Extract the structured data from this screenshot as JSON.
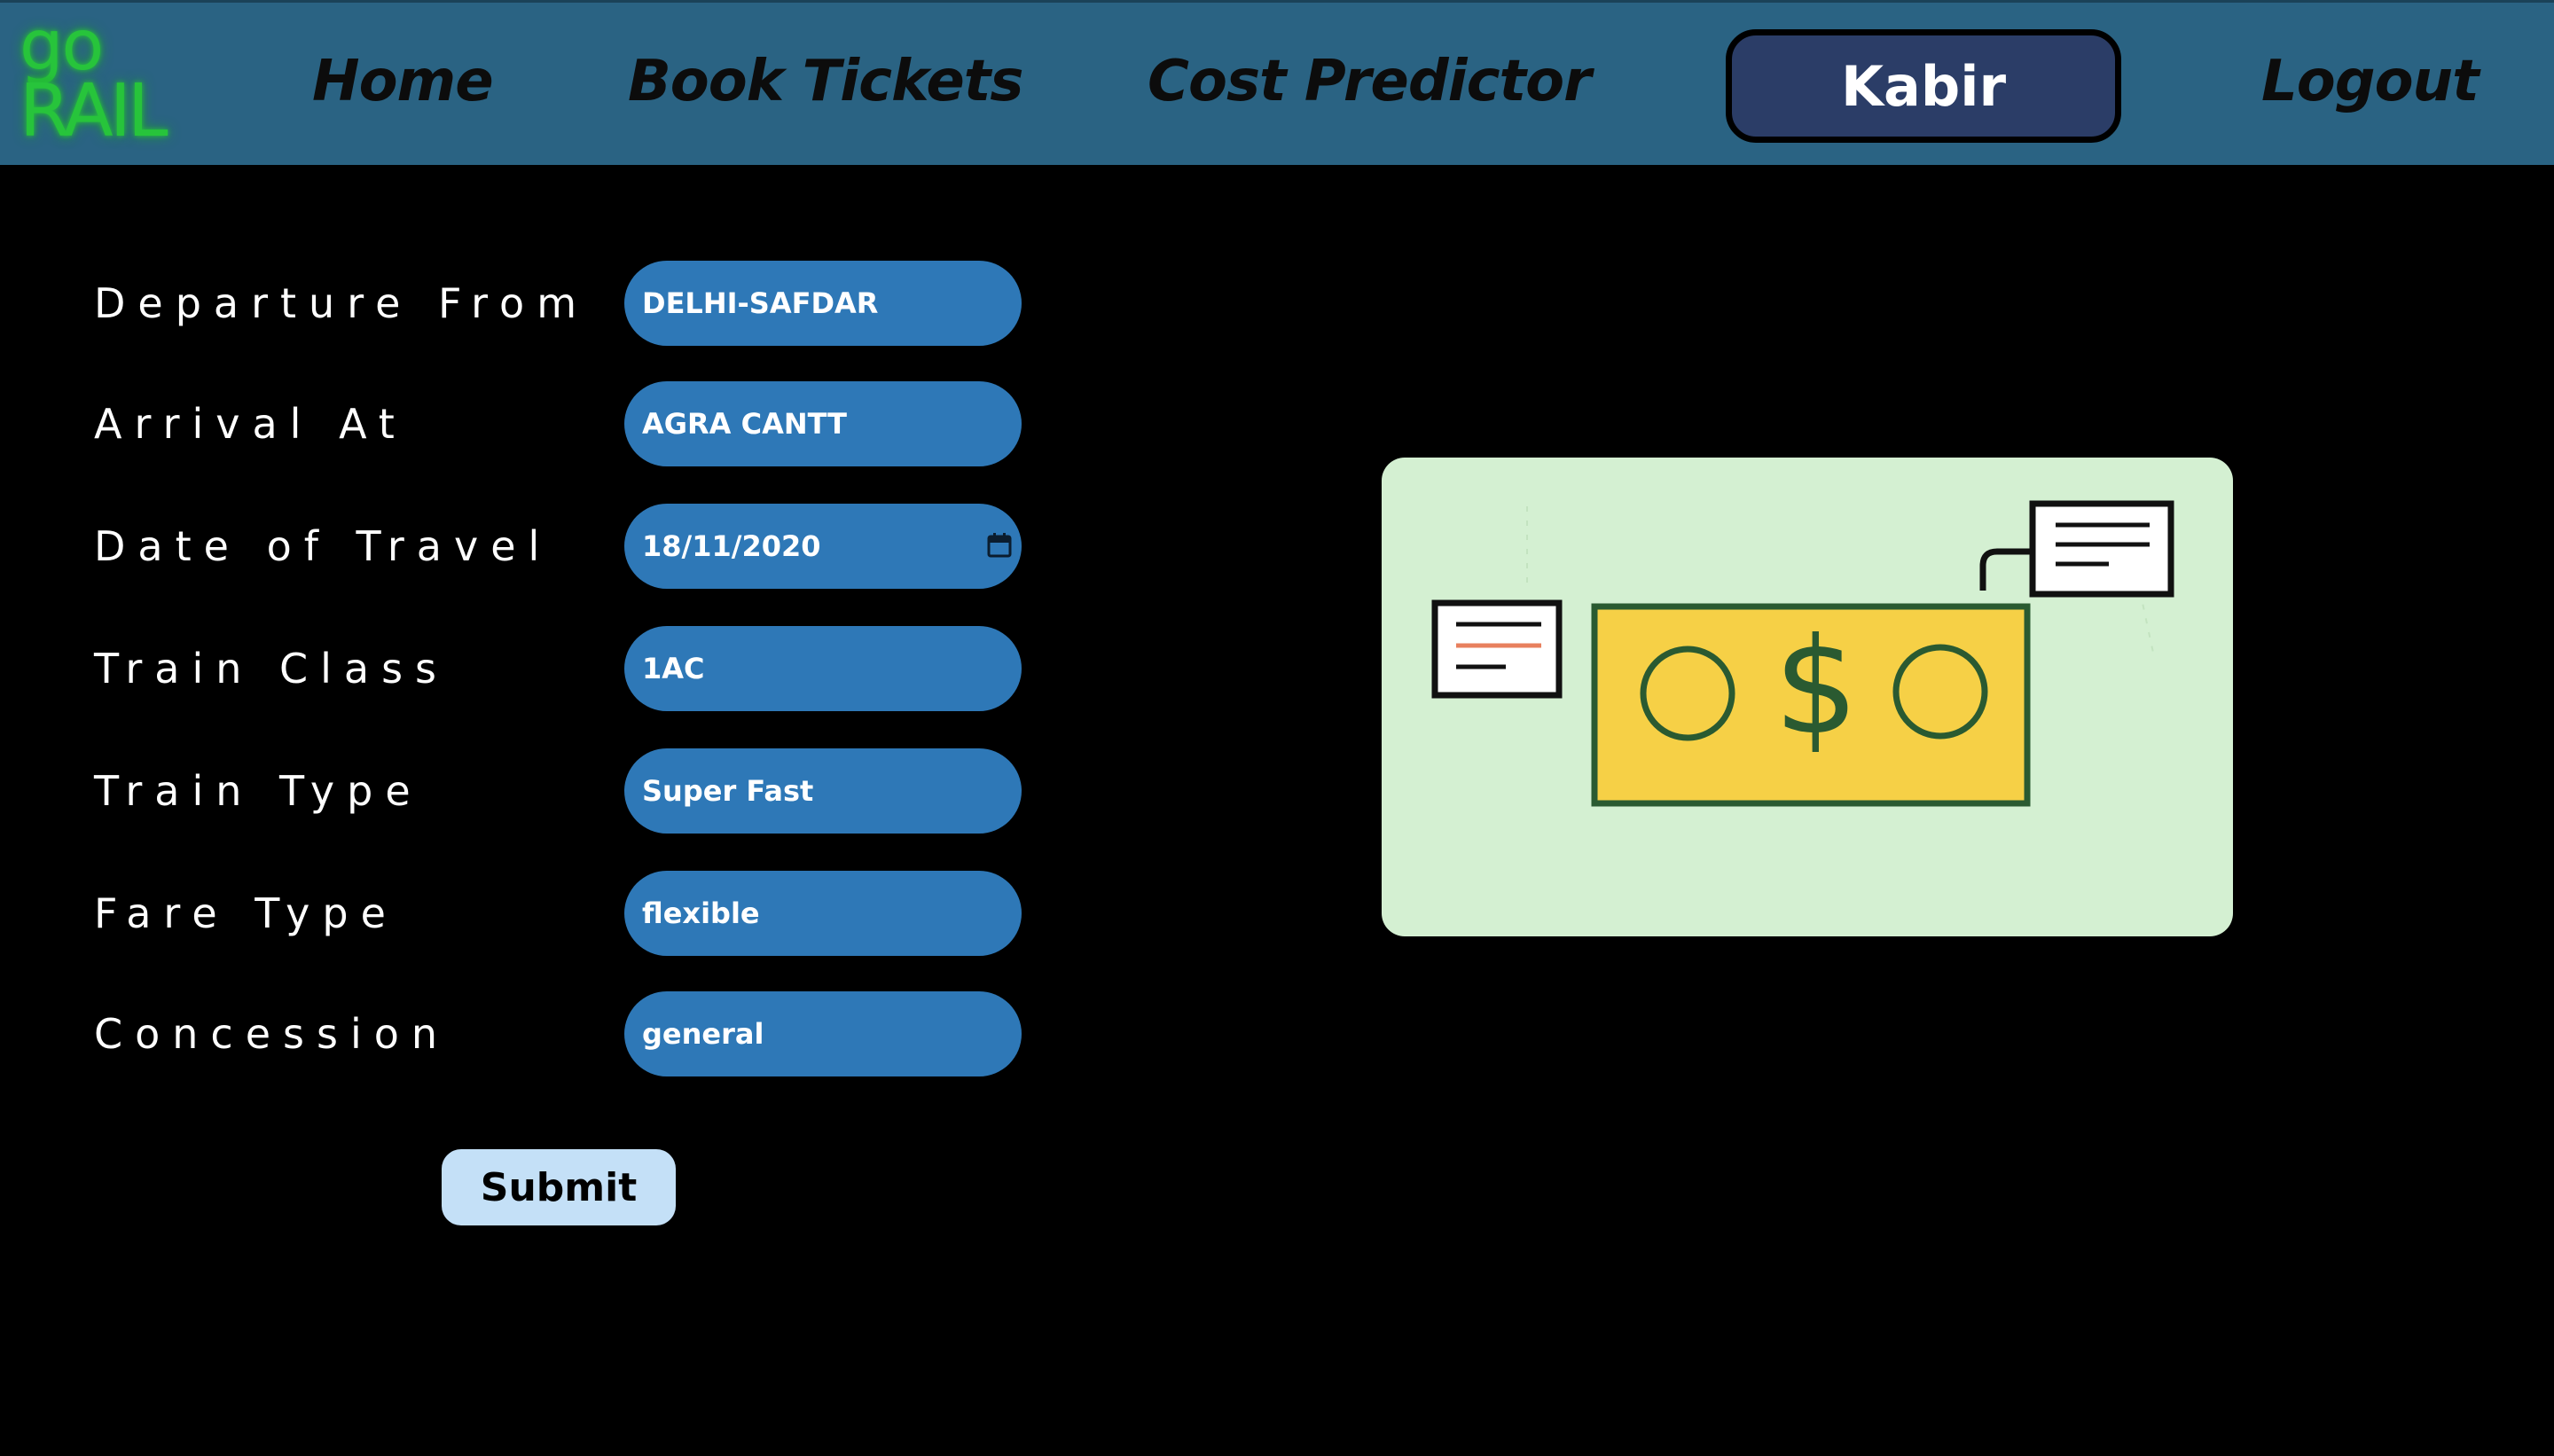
{
  "app": {
    "logo_line1": "go",
    "logo_line2": "RAIL"
  },
  "nav": {
    "home": "Home",
    "book_tickets": "Book Tickets",
    "cost_predictor": "Cost Predictor",
    "user": "Kabir",
    "logout": "Logout"
  },
  "form": {
    "fields": [
      {
        "label": "Departure From",
        "value": "DELHI-SAFDAR"
      },
      {
        "label": "Arrival At",
        "value": "AGRA CANTT"
      },
      {
        "label": "Date of Travel",
        "value": "18/11/2020"
      },
      {
        "label": "Train Class",
        "value": "1AC"
      },
      {
        "label": "Train Type",
        "value": "Super Fast"
      },
      {
        "label": "Fare Type",
        "value": "flexible"
      },
      {
        "label": "Concession",
        "value": "general"
      }
    ],
    "submit_label": "Submit"
  },
  "illustration": {
    "currency_symbol": "$",
    "colors": {
      "card_bg": "#d4f0d2",
      "bill_fill": "#f6d046",
      "bill_stroke": "#2a5a31",
      "accent_line": "#e8805e"
    }
  },
  "colors": {
    "navbar": "#2a6383",
    "field": "#2e78b7",
    "user_pill": "#2b3d67",
    "logo": "#27c43b",
    "submit": "#c4e0f7"
  }
}
